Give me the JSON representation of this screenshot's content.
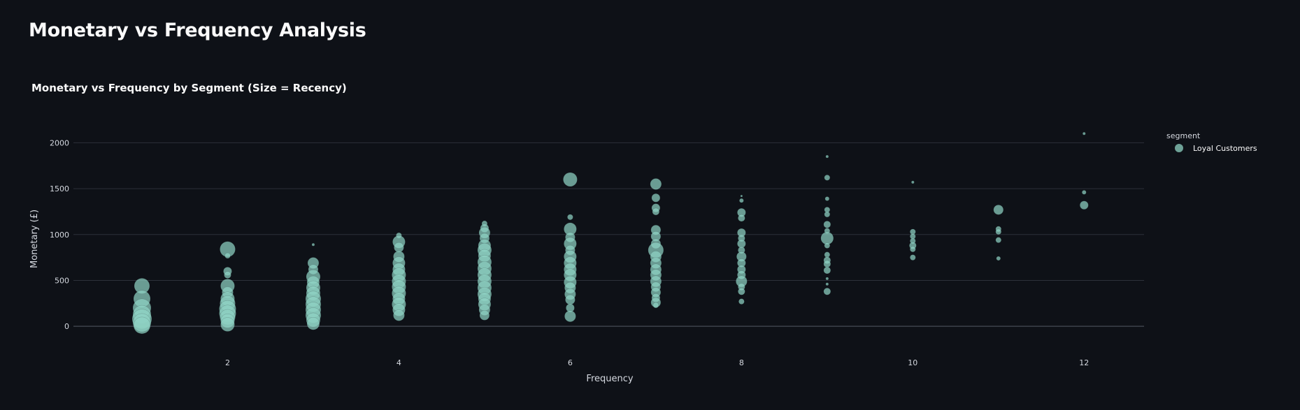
{
  "page": {
    "title": "Monetary vs Frequency Analysis"
  },
  "chart_data": {
    "type": "scatter",
    "title": "Monetary vs Frequency by Segment (Size = Recency)",
    "xlabel": "Frequency",
    "ylabel": "Monetary (£)",
    "xlim": [
      0.2,
      12.7
    ],
    "ylim": [
      -250,
      2300
    ],
    "x_ticks": [
      2,
      4,
      6,
      8,
      10,
      12
    ],
    "y_ticks": [
      0,
      500,
      1000,
      1500,
      2000
    ],
    "grid": "horizontal",
    "legend": {
      "title": "segment",
      "placement": "top-right"
    },
    "color": "#8fd3c3",
    "series": [
      {
        "name": "Loyal Customers",
        "points": [
          [
            1,
            440,
            11
          ],
          [
            1,
            300,
            12
          ],
          [
            1,
            200,
            13
          ],
          [
            1,
            130,
            13
          ],
          [
            1,
            80,
            14
          ],
          [
            1,
            40,
            13
          ],
          [
            1,
            10,
            12
          ],
          [
            2,
            840,
            11
          ],
          [
            2,
            770,
            4
          ],
          [
            2,
            600,
            6
          ],
          [
            2,
            560,
            5
          ],
          [
            2,
            440,
            10
          ],
          [
            2,
            370,
            8
          ],
          [
            2,
            300,
            10
          ],
          [
            2,
            250,
            11
          ],
          [
            2,
            190,
            12
          ],
          [
            2,
            140,
            12
          ],
          [
            2,
            100,
            11
          ],
          [
            2,
            60,
            10
          ],
          [
            2,
            20,
            10
          ],
          [
            3,
            890,
            2
          ],
          [
            3,
            690,
            8
          ],
          [
            3,
            620,
            7
          ],
          [
            3,
            540,
            10
          ],
          [
            3,
            480,
            9
          ],
          [
            3,
            420,
            10
          ],
          [
            3,
            360,
            10
          ],
          [
            3,
            300,
            11
          ],
          [
            3,
            240,
            11
          ],
          [
            3,
            180,
            11
          ],
          [
            3,
            120,
            11
          ],
          [
            3,
            70,
            10
          ],
          [
            3,
            30,
            9
          ],
          [
            4,
            990,
            4
          ],
          [
            4,
            920,
            9
          ],
          [
            4,
            860,
            7
          ],
          [
            4,
            760,
            8
          ],
          [
            4,
            690,
            9
          ],
          [
            4,
            620,
            9
          ],
          [
            4,
            560,
            10
          ],
          [
            4,
            490,
            10
          ],
          [
            4,
            430,
            10
          ],
          [
            4,
            360,
            10
          ],
          [
            4,
            300,
            9
          ],
          [
            4,
            240,
            10
          ],
          [
            4,
            180,
            9
          ],
          [
            4,
            120,
            8
          ],
          [
            5,
            1120,
            4
          ],
          [
            5,
            1070,
            6
          ],
          [
            5,
            1020,
            8
          ],
          [
            5,
            960,
            7
          ],
          [
            5,
            880,
            9
          ],
          [
            5,
            830,
            10
          ],
          [
            5,
            770,
            9
          ],
          [
            5,
            700,
            10
          ],
          [
            5,
            630,
            10
          ],
          [
            5,
            560,
            10
          ],
          [
            5,
            490,
            10
          ],
          [
            5,
            420,
            10
          ],
          [
            5,
            350,
            10
          ],
          [
            5,
            300,
            9
          ],
          [
            5,
            240,
            9
          ],
          [
            5,
            180,
            8
          ],
          [
            5,
            120,
            7
          ],
          [
            6,
            1600,
            10
          ],
          [
            6,
            1190,
            4
          ],
          [
            6,
            1060,
            9
          ],
          [
            6,
            970,
            7
          ],
          [
            6,
            900,
            9
          ],
          [
            6,
            830,
            7
          ],
          [
            6,
            760,
            9
          ],
          [
            6,
            690,
            9
          ],
          [
            6,
            620,
            9
          ],
          [
            6,
            560,
            9
          ],
          [
            6,
            480,
            9
          ],
          [
            6,
            420,
            8
          ],
          [
            6,
            350,
            8
          ],
          [
            6,
            290,
            7
          ],
          [
            6,
            200,
            6
          ],
          [
            6,
            110,
            8
          ],
          [
            7,
            1550,
            8
          ],
          [
            7,
            1400,
            6
          ],
          [
            7,
            1290,
            6
          ],
          [
            7,
            1250,
            5
          ],
          [
            7,
            1050,
            7
          ],
          [
            7,
            980,
            7
          ],
          [
            7,
            900,
            7
          ],
          [
            7,
            830,
            11
          ],
          [
            7,
            760,
            8
          ],
          [
            7,
            690,
            8
          ],
          [
            7,
            620,
            8
          ],
          [
            7,
            560,
            8
          ],
          [
            7,
            490,
            8
          ],
          [
            7,
            430,
            7
          ],
          [
            7,
            370,
            7
          ],
          [
            7,
            310,
            6
          ],
          [
            7,
            260,
            7
          ],
          [
            7,
            230,
            4
          ],
          [
            8,
            1420,
            1
          ],
          [
            8,
            1370,
            3
          ],
          [
            8,
            1240,
            6
          ],
          [
            8,
            1180,
            5
          ],
          [
            8,
            1020,
            6
          ],
          [
            8,
            960,
            5
          ],
          [
            8,
            900,
            6
          ],
          [
            8,
            830,
            5
          ],
          [
            8,
            760,
            7
          ],
          [
            8,
            690,
            6
          ],
          [
            8,
            620,
            6
          ],
          [
            8,
            560,
            6
          ],
          [
            8,
            490,
            8
          ],
          [
            8,
            430,
            5
          ],
          [
            8,
            380,
            5
          ],
          [
            8,
            270,
            4
          ],
          [
            9,
            1850,
            2
          ],
          [
            9,
            1620,
            4
          ],
          [
            9,
            1390,
            3
          ],
          [
            9,
            1270,
            4
          ],
          [
            9,
            1220,
            4
          ],
          [
            9,
            1110,
            5
          ],
          [
            9,
            1040,
            4
          ],
          [
            9,
            960,
            9
          ],
          [
            9,
            880,
            4
          ],
          [
            9,
            780,
            4
          ],
          [
            9,
            720,
            5
          ],
          [
            9,
            680,
            5
          ],
          [
            9,
            610,
            5
          ],
          [
            9,
            520,
            2
          ],
          [
            9,
            460,
            2
          ],
          [
            9,
            380,
            5
          ],
          [
            10,
            1570,
            2
          ],
          [
            10,
            1030,
            4
          ],
          [
            10,
            980,
            4
          ],
          [
            10,
            930,
            4
          ],
          [
            10,
            880,
            5
          ],
          [
            10,
            840,
            4
          ],
          [
            10,
            750,
            4
          ],
          [
            11,
            1270,
            7
          ],
          [
            11,
            1060,
            4
          ],
          [
            11,
            1030,
            4
          ],
          [
            11,
            940,
            4
          ],
          [
            11,
            740,
            3
          ],
          [
            12,
            2100,
            2
          ],
          [
            12,
            1460,
            3
          ],
          [
            12,
            1320,
            6
          ]
        ]
      }
    ]
  }
}
